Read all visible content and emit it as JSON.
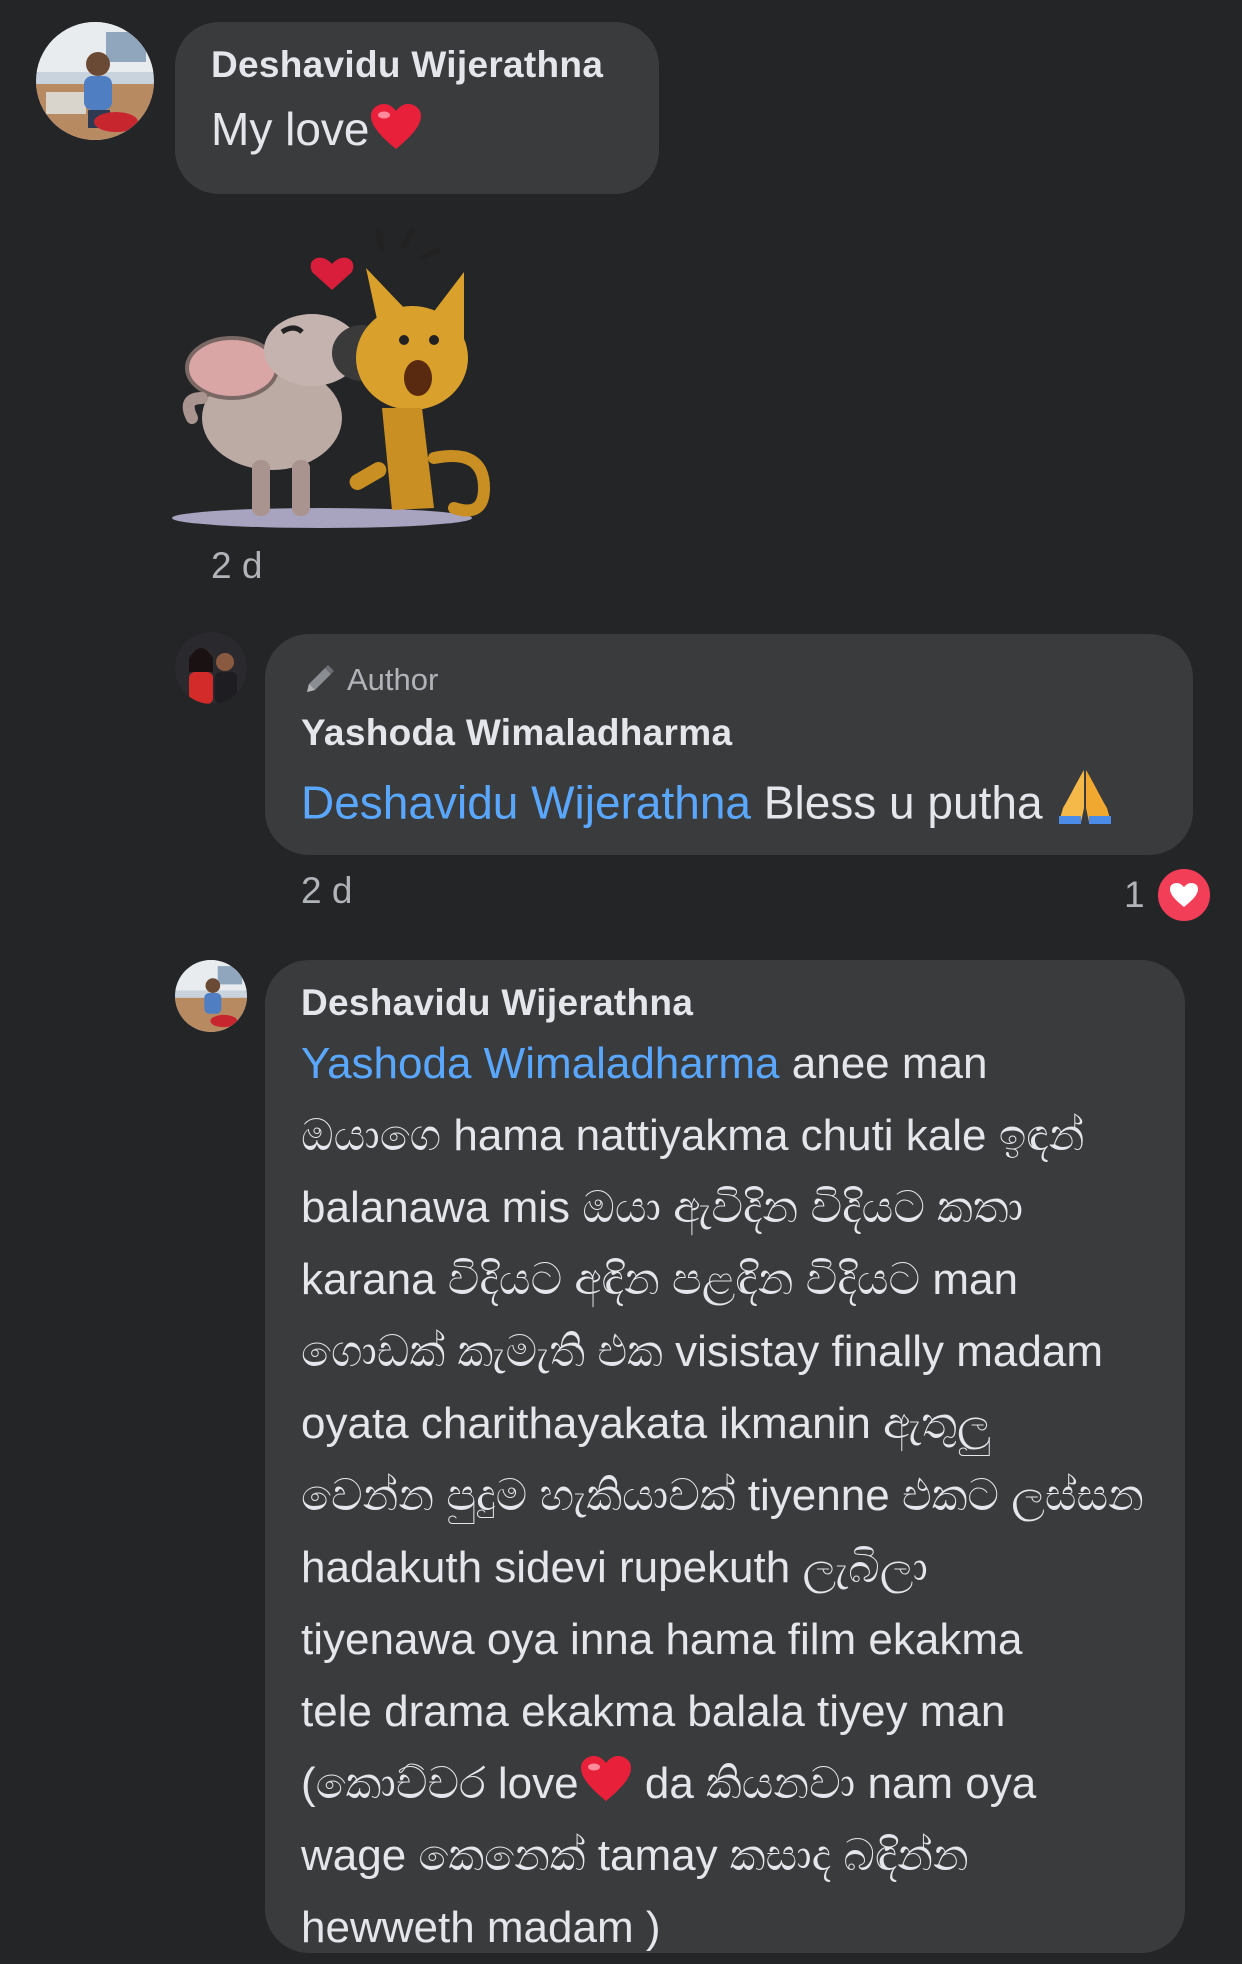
{
  "comments": [
    {
      "author": "Deshavidu Wijerathna",
      "text": "My love",
      "emoji": "red-heart",
      "sticker": "mouse-kissing-cat-sticker",
      "time": "2 d"
    },
    {
      "badge": "Author",
      "author": "Yashoda Wimaladharma",
      "mention": "Deshavidu Wijerathna",
      "text": " Bless u putha ",
      "emoji": "folded-hands",
      "time": "2 d",
      "reaction_count": "1",
      "reaction": "love"
    },
    {
      "author": "Deshavidu Wijerathna",
      "mention": "Yashoda Wimaladharma",
      "lines": [
        " anee man",
        "ඔයාගෙ hama nattiyakma chuti kale ඉඳන්",
        "balanawa mis ඔයා ඇවිදින විදියට කතා",
        "karana විදියට අඳින පළඳින විදියට man",
        "ගොඩක් කැමැති එක visistay finally madam",
        "oyata charithayakata ikmanin ඇතුලු",
        "වෙන්න  පුදුම හැකියාවක් tiyenne එකට ලස්සන",
        "hadakuth sidevi rupekuth ලැබිලා",
        "tiyenawa oya inna hama film ekakma",
        "tele drama ekakma balala tiyey man",
        "(කොච්චර love",
        "wage කෙනෙක් tamay කසාද බඳින්න",
        "hewweth madam )"
      ],
      "line11_after_emoji": " da කියනවා nam oya"
    }
  ],
  "colors": {
    "background": "#242527",
    "bubble": "#3a3b3c",
    "mention": "#5aa7ff",
    "meta": "#b0b3b8",
    "love_reaction": "#f33e58"
  }
}
